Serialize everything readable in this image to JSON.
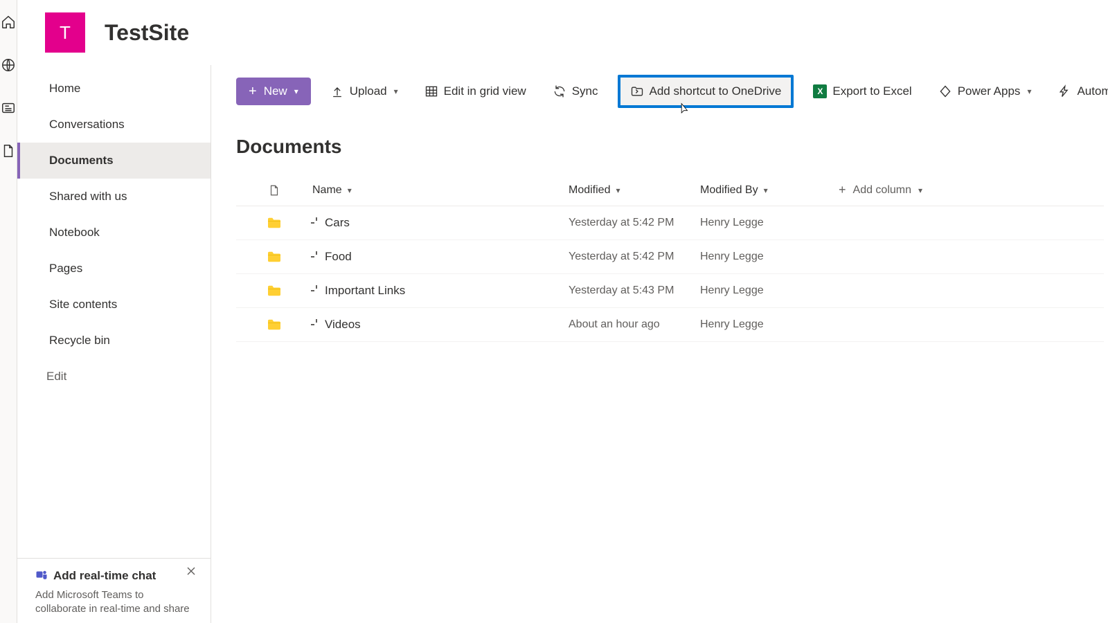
{
  "site": {
    "logo_letter": "T",
    "title": "TestSite"
  },
  "rail": {
    "icons": [
      "home",
      "globe",
      "app",
      "document"
    ]
  },
  "sidebar": {
    "items": [
      {
        "label": "Home"
      },
      {
        "label": "Conversations"
      },
      {
        "label": "Documents",
        "selected": true
      },
      {
        "label": "Shared with us"
      },
      {
        "label": "Notebook"
      },
      {
        "label": "Pages"
      },
      {
        "label": "Site contents"
      },
      {
        "label": "Recycle bin"
      }
    ],
    "edit_label": "Edit",
    "promo": {
      "title": "Add real-time chat",
      "desc": "Add Microsoft Teams to collaborate in real-time and share"
    }
  },
  "commands": {
    "new": "New",
    "upload": "Upload",
    "edit_grid": "Edit in grid view",
    "sync": "Sync",
    "shortcut": "Add shortcut to OneDrive",
    "export": "Export to Excel",
    "powerapps": "Power Apps",
    "automate": "Automate"
  },
  "list": {
    "title": "Documents",
    "columns": {
      "name": "Name",
      "modified": "Modified",
      "modified_by": "Modified By",
      "add": "Add column"
    },
    "rows": [
      {
        "name": "Cars",
        "modified": "Yesterday at 5:42 PM",
        "modified_by": "Henry Legge"
      },
      {
        "name": "Food",
        "modified": "Yesterday at 5:42 PM",
        "modified_by": "Henry Legge"
      },
      {
        "name": "Important Links",
        "modified": "Yesterday at 5:43 PM",
        "modified_by": "Henry Legge"
      },
      {
        "name": "Videos",
        "modified": "About an hour ago",
        "modified_by": "Henry Legge"
      }
    ]
  }
}
